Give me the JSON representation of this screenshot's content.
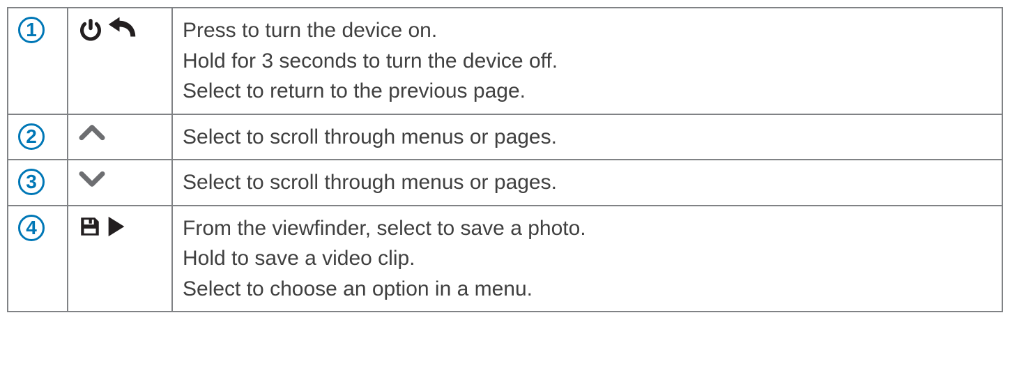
{
  "rows": [
    {
      "num": "1",
      "icons": [
        "power",
        "undo"
      ],
      "lines": [
        "Press to turn the device on.",
        "Hold for 3 seconds to turn the device off.",
        "Select to return to the previous page."
      ]
    },
    {
      "num": "2",
      "icons": [
        "chevron-up"
      ],
      "lines": [
        "Select to scroll through menus or pages."
      ]
    },
    {
      "num": "3",
      "icons": [
        "chevron-down"
      ],
      "lines": [
        "Select to scroll through menus or pages."
      ]
    },
    {
      "num": "4",
      "icons": [
        "save",
        "play"
      ],
      "lines": [
        "From the viewfinder, select to save a photo.",
        "Hold to save a video clip.",
        "Select to choose an option in a menu."
      ]
    }
  ]
}
